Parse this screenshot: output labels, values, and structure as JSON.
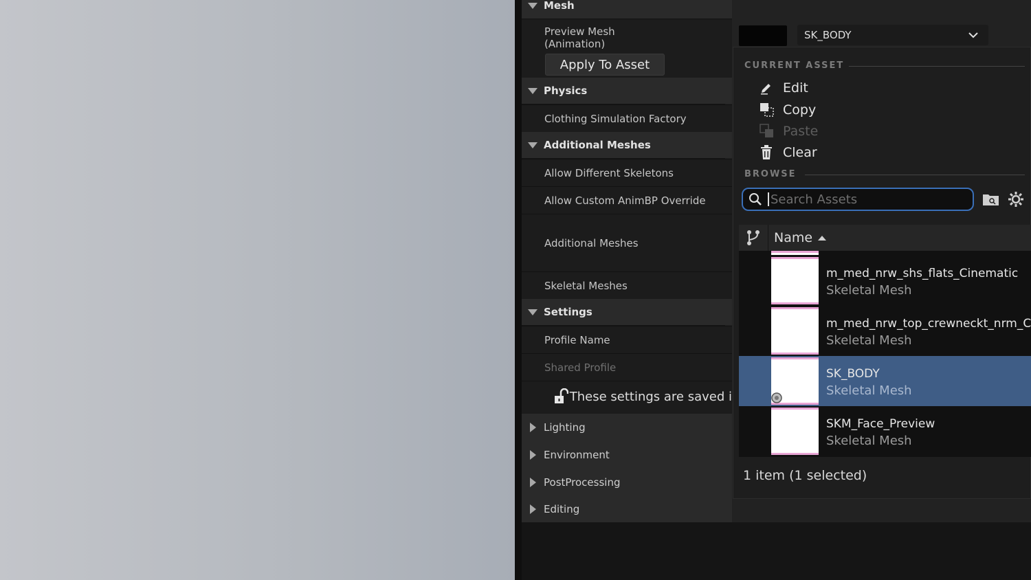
{
  "details": {
    "sections": {
      "mesh": "Mesh",
      "physics": "Physics",
      "additional_meshes": "Additional Meshes",
      "settings": "Settings",
      "lighting": "Lighting",
      "environment": "Environment",
      "postprocessing": "PostProcessing",
      "editing": "Editing"
    },
    "properties": {
      "preview_mesh_line1": "Preview Mesh",
      "preview_mesh_line2": "(Animation)",
      "apply_to_asset": "Apply To Asset",
      "clothing_factory": "Clothing Simulation Factory",
      "allow_diff_skeletons": "Allow Different Skeletons",
      "allow_custom_animbp": "Allow Custom AnimBP Override",
      "additional_meshes": "Additional Meshes",
      "skeletal_meshes": "Skeletal Meshes",
      "profile_name": "Profile Name",
      "shared_profile": "Shared Profile",
      "settings_saved": "These settings are saved i"
    },
    "preview_mesh_value": "SK_BODY"
  },
  "popup": {
    "current_asset_heading": "CURRENT ASSET",
    "menu": {
      "edit": "Edit",
      "copy": "Copy",
      "paste": "Paste",
      "clear": "Clear"
    },
    "browse_heading": "BROWSE",
    "search_placeholder": "Search Assets",
    "column_name": "Name",
    "assets": [
      {
        "name": "m_med_nrw_shs_flats_Cinematic",
        "type": "Skeletal Mesh"
      },
      {
        "name": "m_med_nrw_top_crewneckt_nrm_Cine",
        "type": "Skeletal Mesh"
      },
      {
        "name": "SK_BODY",
        "type": "Skeletal Mesh"
      },
      {
        "name": "SKM_Face_Preview",
        "type": "Skeletal Mesh"
      }
    ],
    "status": "1 item (1 selected)"
  }
}
